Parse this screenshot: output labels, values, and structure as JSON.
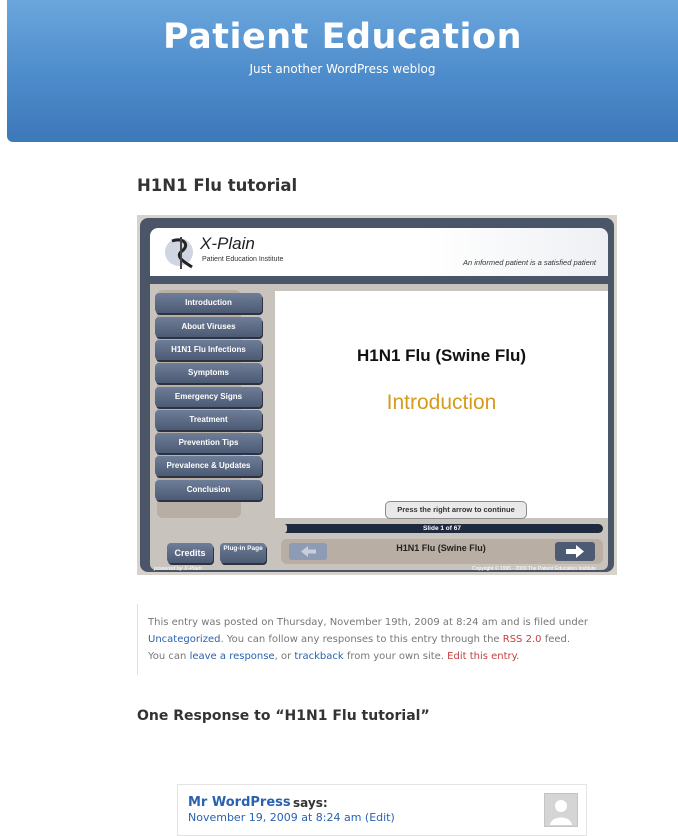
{
  "header": {
    "site_title": "Patient Education",
    "site_description": "Just another WordPress weblog"
  },
  "post": {
    "title": "H1N1 Flu tutorial"
  },
  "xplain": {
    "logo_text": "X-Plain",
    "logo_sub": "Patient Education Institute",
    "tagline": "An informed patient is a satisfied patient",
    "menu": [
      "Introduction",
      "About Viruses",
      "H1N1 Flu Infections",
      "Symptoms",
      "Emergency Signs",
      "Treatment",
      "Prevention Tips",
      "Prevalence & Updates",
      "Conclusion"
    ],
    "slide_title": "H1N1 Flu (Swine Flu)",
    "slide_subtitle": "Introduction",
    "continue_hint": "Press the right arrow to continue",
    "progress_label": "Slide 1 of 67",
    "progress_value": 0.015,
    "nav_title": "H1N1 Flu (Swine Flu)",
    "credits_label": "Credits",
    "plugin_label": "Plug-in Page",
    "powered_by": "powered by X-Plain",
    "copyright": "Copyright © 1995 - 2009 The Patient Education Institute"
  },
  "postmeta": {
    "text_1": "This entry was posted on Thursday, November 19th, 2009 at 8:24 am and is filed under",
    "category": "Uncategorized",
    "text_2": ". You can follow any responses to this entry through the",
    "rss": "RSS 2.0",
    "text_3": "feed.",
    "text_4": "You can",
    "leave_response": "leave a response",
    "text_5": ", or",
    "trackback": "trackback",
    "text_6": "from your own site.",
    "edit": "Edit this entry",
    "text_7": "."
  },
  "responses": {
    "heading": "One Response to “H1N1 Flu tutorial”"
  },
  "comment": {
    "author": "Mr WordPress",
    "says": "says:",
    "date": "November 19, 2009 at 8:24 am",
    "edit": "(Edit)"
  }
}
